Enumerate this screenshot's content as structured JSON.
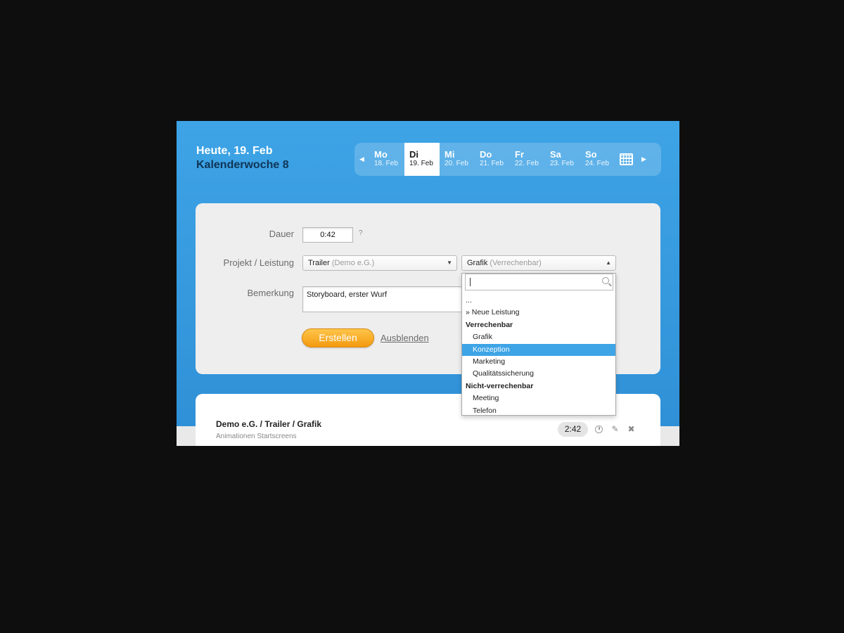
{
  "header": {
    "today": "Heute, 19. Feb",
    "week": "Kalenderwoche 8"
  },
  "weeknav": {
    "days": [
      {
        "name": "Mo",
        "date": "18. Feb"
      },
      {
        "name": "Di",
        "date": "19. Feb"
      },
      {
        "name": "Mi",
        "date": "20. Feb"
      },
      {
        "name": "Do",
        "date": "21. Feb"
      },
      {
        "name": "Fr",
        "date": "22. Feb"
      },
      {
        "name": "Sa",
        "date": "23. Feb"
      },
      {
        "name": "So",
        "date": "24. Feb"
      }
    ],
    "active_index": 1
  },
  "form": {
    "duration_label": "Dauer",
    "duration_value": "0:42",
    "help": "?",
    "project_label": "Projekt / Leistung",
    "project_value": "Trailer",
    "project_sub": "(Demo e.G.)",
    "service_value": "Grafik",
    "service_sub": "(Verrechenbar)",
    "remark_label": "Bemerkung",
    "remark_value": "Storyboard, erster Wurf",
    "create_label": "Erstellen",
    "hide_label": "Ausblenden"
  },
  "dropdown": {
    "items": [
      {
        "label": "...",
        "kind": "plain"
      },
      {
        "label": "» Neue Leistung",
        "kind": "plain"
      },
      {
        "label": "Verrechenbar",
        "kind": "group"
      },
      {
        "label": "Grafik",
        "kind": "item"
      },
      {
        "label": "Konzeption",
        "kind": "item",
        "selected": true
      },
      {
        "label": "Marketing",
        "kind": "item"
      },
      {
        "label": "Qualitätssicherung",
        "kind": "item"
      },
      {
        "label": "Nicht-verrechenbar",
        "kind": "group"
      },
      {
        "label": "Meeting",
        "kind": "item"
      },
      {
        "label": "Telefon",
        "kind": "item"
      }
    ]
  },
  "entry": {
    "title": "Demo e.G. / Trailer / Grafik",
    "subtitle": "Animationen Startscreens",
    "time": "2:42"
  },
  "icons": {
    "prev": "chevron-left-icon",
    "next": "chevron-right-icon",
    "calendar": "calendar-icon",
    "search": "search-icon",
    "clock": "clock-icon",
    "edit": "pencil-icon",
    "delete": "close-icon"
  },
  "colors": {
    "header_blue": "#3ea4e6",
    "accent_orange": "#f39a0f",
    "selected_blue": "#3ea4e6"
  }
}
